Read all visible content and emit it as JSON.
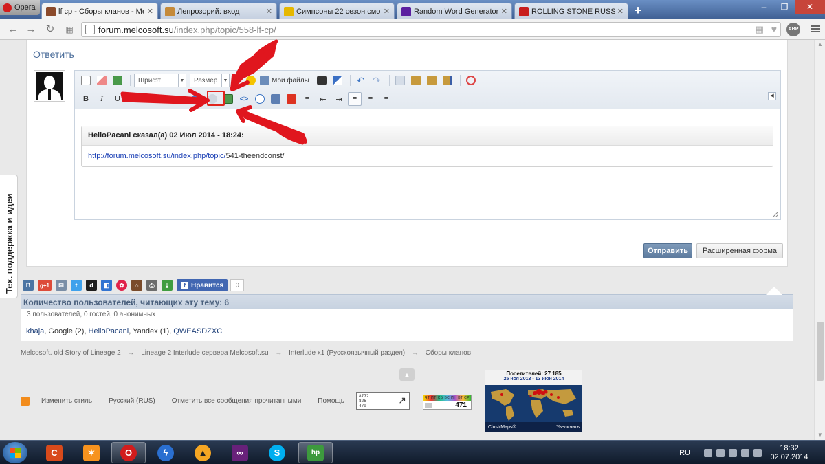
{
  "browser": {
    "opera_label": "Opera",
    "tabs": [
      {
        "title": "lf cp - Сборы кланов - Ме",
        "active": true,
        "favicon_color": "#8b4a2b"
      },
      {
        "title": "Лепрозорий: вход",
        "active": false,
        "favicon_color": "#c58a3a"
      },
      {
        "title": "Симпсоны 22 сезон смо",
        "active": false,
        "favicon_color": "#e6b800"
      },
      {
        "title": "Random Word Generator",
        "active": false,
        "favicon_color": "#5b1fa0"
      },
      {
        "title": "ROLLING STONE RUSSIA",
        "active": false,
        "favicon_color": "#c81e1e"
      }
    ],
    "new_tab": "+",
    "url_host": "forum.melcosoft.su",
    "url_path": "/index.php/topic/558-lf-cp/",
    "abp_label": "ABP"
  },
  "reply": {
    "title": "Ответить",
    "font_select": "Шрифт",
    "size_select": "Размер",
    "my_files": "Мои файлы",
    "toolbar_row2": {
      "bold": "B",
      "italic": "I",
      "underline": "U"
    },
    "quote": {
      "header": "HelloPacani сказал(а) 02 Июл 2014 - 18:24:",
      "link_text": "http://forum.melcosoft.su/index.php/topic/",
      "link_rest": "541-theendconst/"
    },
    "submit_label": "Отправить",
    "advanced_label": "Расширенная форма"
  },
  "side_tab": "Тех. поддержка и идеи",
  "share": {
    "icons": [
      {
        "name": "vk-icon",
        "glyph": "B",
        "color": "#4c75a3"
      },
      {
        "name": "googleplus-icon",
        "glyph": "g+1",
        "color": "#dd4b39"
      },
      {
        "name": "email-icon",
        "glyph": "✉",
        "color": "#7a8ea6"
      },
      {
        "name": "twitter-icon",
        "glyph": "t",
        "color": "#3ea1ec"
      },
      {
        "name": "digg-icon",
        "glyph": "d",
        "color": "#1d1d1d"
      },
      {
        "name": "delicious-icon",
        "glyph": "◧",
        "color": "#3274d1"
      },
      {
        "name": "favorite-star-icon",
        "glyph": "✿",
        "color": "#e0224a"
      },
      {
        "name": "home-icon",
        "glyph": "⌂",
        "color": "#7a4b2b"
      },
      {
        "name": "print-icon",
        "glyph": "⎙",
        "color": "#6d6d6d"
      },
      {
        "name": "download-icon",
        "glyph": "⤓",
        "color": "#3f9d3f"
      }
    ],
    "fb_like": "Нравится",
    "fb_count": "0"
  },
  "readers": {
    "title": "Количество пользователей, читающих эту тему: 6",
    "summary": "3 пользователей, 0 гостей, 0 анонимных",
    "list": [
      {
        "name": "khaja",
        "suffix": ", "
      },
      {
        "name": "Google (2)",
        "suffix": ", "
      },
      {
        "name": "HelloPacani",
        "suffix": ", "
      },
      {
        "name": "Yandex (1)",
        "suffix": ", "
      },
      {
        "name": "QWEASDZXC",
        "suffix": ""
      }
    ]
  },
  "breadcrumb": [
    "Melcosoft. old Story of Lineage 2",
    "Lineage 2 Interlude сервера Melcosoft.su",
    "Interlude x1 (Русскоязычный раздел)",
    "Сборы кланов"
  ],
  "breadcrumb_sep": "→",
  "footer": {
    "links": [
      "Изменить стиль",
      "Русский (RUS)",
      "Отметить все сообщения прочитанными",
      "Помощь"
    ],
    "counter1_lines": [
      "8772",
      "826",
      "479"
    ],
    "counter2_days": "ЧТ ПТ СБ ВС ПН ВТ СР",
    "counter2_value": "471",
    "clustr_title": "Посетителей: 27 185",
    "clustr_dates": "25 ноя 2013 - 13 июн 2014",
    "clustr_brand": "ClustrMaps®",
    "clustr_zoom": "Увеличить"
  },
  "taskbar": {
    "apps": [
      {
        "name": "ccleaner-icon",
        "glyph": "C",
        "color": "#d84a1b",
        "open": false
      },
      {
        "name": "avast-icon",
        "glyph": "✶",
        "color": "#f7931e",
        "open": false
      },
      {
        "name": "opera-icon",
        "glyph": "O",
        "color": "#d21c1c",
        "open": true
      },
      {
        "name": "thunder-icon",
        "glyph": "ϟ",
        "color": "#2a6fd0",
        "open": false
      },
      {
        "name": "aimp-icon",
        "glyph": "▲",
        "color": "#f5a623",
        "open": false
      },
      {
        "name": "visualstudio-icon",
        "glyph": "∞",
        "color": "#68217a",
        "open": false
      },
      {
        "name": "skype-icon",
        "glyph": "S",
        "color": "#00aff0",
        "open": false
      },
      {
        "name": "hp-icon",
        "glyph": "hp",
        "color": "#3d9a3d",
        "open": true
      }
    ],
    "lang": "RU",
    "time": "18:32",
    "date": "02.07.2014"
  }
}
